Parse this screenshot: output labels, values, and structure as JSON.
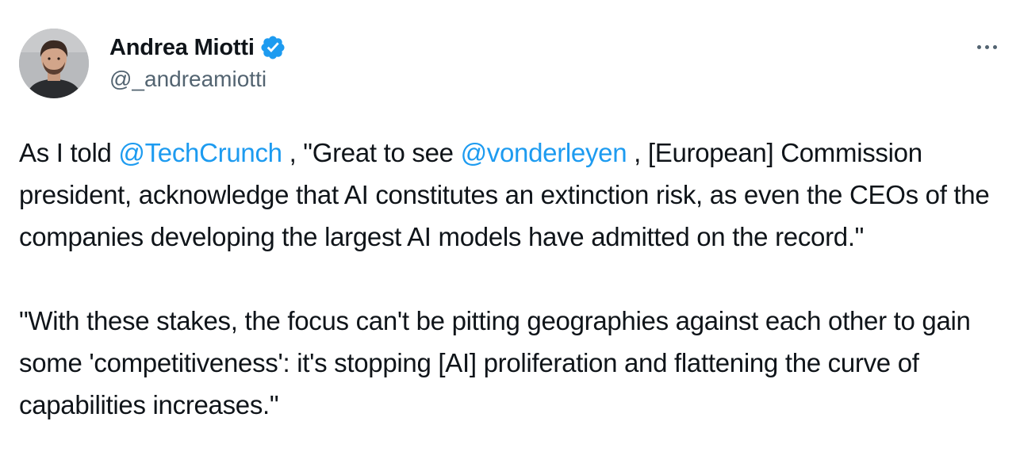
{
  "author": {
    "display_name": "Andrea Miotti",
    "handle": "@_andreamiotti",
    "verified_icon": "verified-badge-icon",
    "verified_color": "#1d9bf0"
  },
  "menu": {
    "icon": "more-horizontal-icon"
  },
  "tweet": {
    "p1_pre": "As I told ",
    "mention1": "@TechCrunch",
    "p1_mid": " , \"Great to see ",
    "mention2": "@vonderleyen",
    "p1_post": " , [European] Commission president, acknowledge that AI constitutes an extinction risk, as even the CEOs of the companies developing the largest AI models have admitted on the record.\"",
    "p2": "\"With these stakes, the focus can't be pitting geographies against each other to gain some 'competitiveness': it's stopping [AI] proliferation and flattening the curve of capabilities increases.\""
  },
  "colors": {
    "text": "#0f1419",
    "secondary": "#536471",
    "link": "#1d9bf0"
  }
}
